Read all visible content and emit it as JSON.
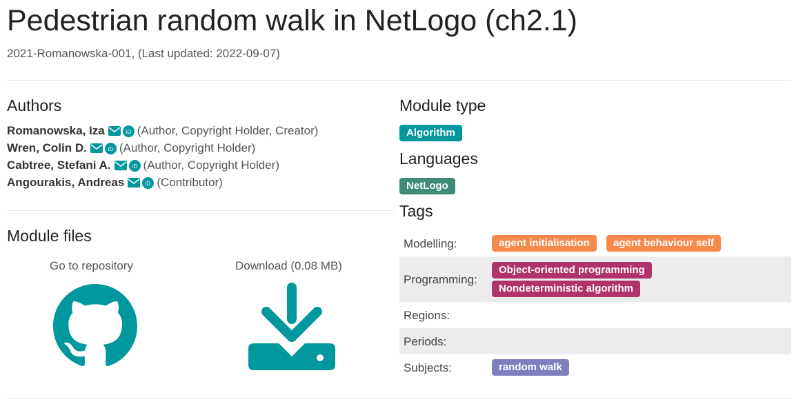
{
  "page": {
    "title": "Pedestrian random walk in NetLogo (ch2.1)",
    "subtitle": "2021-Romanowska-001, (Last updated: 2022-09-07)"
  },
  "authors": {
    "heading": "Authors",
    "list": [
      {
        "name": "Romanowska, Iza",
        "role": "(Author, Copyright Holder, Creator)"
      },
      {
        "name": "Wren, Colin D.",
        "role": "(Author, Copyright Holder)"
      },
      {
        "name": "Cabtree, Stefani A.",
        "role": "(Author, Copyright Holder)"
      },
      {
        "name": "Angourakis, Andreas",
        "role": "(Contributor)"
      }
    ]
  },
  "module_type": {
    "heading": "Module type",
    "value": "Algorithm"
  },
  "languages": {
    "heading": "Languages",
    "value": "NetLogo"
  },
  "tags": {
    "heading": "Tags",
    "rows": [
      {
        "label": "Modelling:",
        "values": [
          "agent initialisation",
          "agent behaviour self"
        ]
      },
      {
        "label": "Programming:",
        "values": [
          "Object-oriented programming",
          "Nondeterministic algorithm"
        ]
      },
      {
        "label": "Regions:",
        "values": []
      },
      {
        "label": "Periods:",
        "values": []
      },
      {
        "label": "Subjects:",
        "values": [
          "random walk"
        ]
      }
    ]
  },
  "module_files": {
    "heading": "Module files",
    "repository_label": "Go to repository",
    "download_label": "Download (0.08 MB)"
  },
  "colors": {
    "teal": "#00979d",
    "netlogo": "#3f8b77",
    "orange": "#f78a4a",
    "magenta": "#b0336b",
    "purple": "#7f7fbf"
  },
  "icons": [
    "envelope-icon",
    "orcid-icon",
    "github-icon",
    "download-icon"
  ]
}
